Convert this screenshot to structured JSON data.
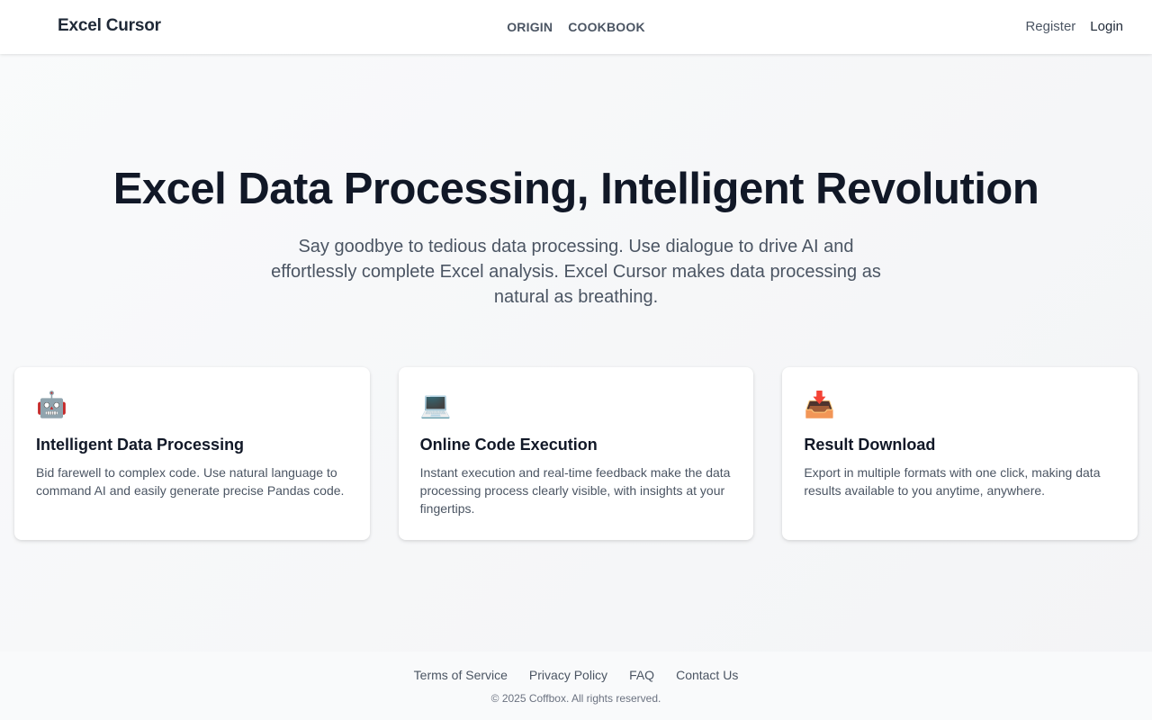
{
  "header": {
    "brand": "Excel Cursor",
    "nav": [
      "ORIGIN",
      "COOKBOOK"
    ],
    "register": "Register",
    "login": "Login"
  },
  "hero": {
    "title": "Excel Data Processing, Intelligent Revolution",
    "subtitle": "Say goodbye to tedious data processing. Use dialogue to drive AI and effortlessly complete Excel analysis. Excel Cursor makes data processing as natural as breathing."
  },
  "features": [
    {
      "icon": "robot-icon",
      "glyph": "🤖",
      "title": "Intelligent Data Processing",
      "desc": "Bid farewell to complex code. Use natural language to command AI and easily generate precise Pandas code."
    },
    {
      "icon": "laptop-icon",
      "glyph": "💻",
      "title": "Online Code Execution",
      "desc": "Instant execution and real-time feedback make the data processing process clearly visible, with insights at your fingertips."
    },
    {
      "icon": "inbox-tray-icon",
      "glyph": "📥",
      "title": "Result Download",
      "desc": "Export in multiple formats with one click, making data results available to you anytime, anywhere."
    }
  ],
  "footer": {
    "links": [
      "Terms of Service",
      "Privacy Policy",
      "FAQ",
      "Contact Us"
    ],
    "copyright": "© 2025 Coffbox. All rights reserved."
  },
  "colors": {
    "text_dark": "#111827",
    "text_muted": "#4b5563",
    "background": "#f3f4f6",
    "card": "#ffffff"
  }
}
